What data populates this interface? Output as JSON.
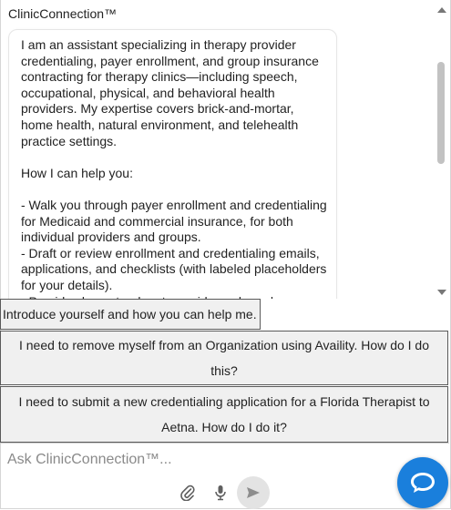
{
  "header": {
    "title": "ClinicConnection™"
  },
  "messages": [
    {
      "role": "assistant",
      "text": "I am an assistant specializing in therapy provider credentialing, payer enrollment, and group insurance contracting for therapy clinics—including speech, occupational, physical, and behavioral health providers. My expertise covers brick-and-mortar, home health, natural environment, and telehealth practice settings.\n\nHow I can help you:\n\n- Walk you through payer enrollment and credentialing for Medicaid and commercial insurance, for both individual providers and groups.\n- Draft or review enrollment and credentialing emails, applications, and checklists (with labeled placeholders for your details).\n- Provide clear, step-by-step guidance based on"
    }
  ],
  "suggestions": [
    {
      "label": "Introduce yourself and how you can help me."
    },
    {
      "label": "I need to remove myself from an Organization using Availity. How do I do this?"
    },
    {
      "label": "I need to submit a new credentialing application for a Florida Therapist to Aetna. How do I do it?"
    }
  ],
  "input": {
    "placeholder": "Ask ClinicConnection™...",
    "value": ""
  },
  "icons": {
    "attach": "paperclip-icon",
    "mic": "microphone-icon",
    "send": "send-icon",
    "chat_launcher": "chat-bubble-icon"
  },
  "colors": {
    "accent": "#1a7fdc",
    "suggestion_bg": "#f0f0f0",
    "send_bg": "#e3e3e3"
  }
}
